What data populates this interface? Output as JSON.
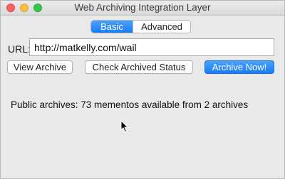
{
  "window": {
    "title": "Web Archiving Integration Layer"
  },
  "tabs": [
    {
      "label": "Basic",
      "active": true
    },
    {
      "label": "Advanced",
      "active": false
    }
  ],
  "url_field": {
    "label": "URL:",
    "value": "http://matkelly.com/wail"
  },
  "buttons": {
    "view_archive": "View Archive",
    "check_status": "Check Archived Status",
    "archive_now": "Archive Now!"
  },
  "status_text": "Public archives: 73 mementos available from 2 archives",
  "colors": {
    "accent": "#1a7cf4",
    "window_bg": "#e9e9e9"
  },
  "icons": [
    "close-icon",
    "minimize-icon",
    "zoom-icon",
    "mouse-cursor-icon"
  ]
}
